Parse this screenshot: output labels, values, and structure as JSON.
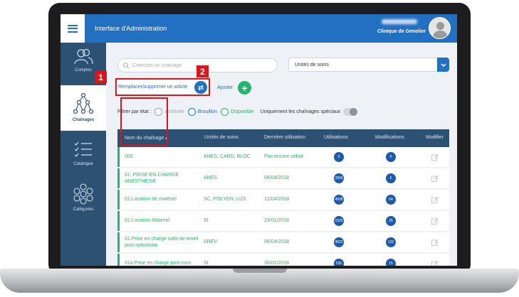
{
  "header": {
    "title": "Interface d'Administration",
    "clinic": "Clinique de Genolier"
  },
  "sidebar": {
    "items": [
      {
        "label": "Comptes",
        "icon": "users-icon"
      },
      {
        "label": "Chaînages",
        "icon": "network-icon",
        "active": true
      },
      {
        "label": "Catalogue",
        "icon": "checklist-icon"
      },
      {
        "label": "Catégories",
        "icon": "categories-icon"
      }
    ]
  },
  "search": {
    "placeholder": "Chercher un chaînage"
  },
  "units_select": {
    "value": "Unités de soins"
  },
  "actions": {
    "replace_label": "Remplacer/supprimer un article",
    "add_label": "Ajouter"
  },
  "badges": {
    "one": "1",
    "two": "2"
  },
  "filter": {
    "label": "Filtrer par état :",
    "options": [
      "Archivée",
      "Brouillon",
      "Disponible"
    ],
    "special_label": "Uniquement les chaînages spéciaux"
  },
  "table": {
    "headers": [
      "Nom du chaînage ▴",
      "Unités de soins",
      "Dernière utilisation",
      "Utilisations",
      "Modifications",
      "Modifier"
    ],
    "rows": [
      {
        "name": "000",
        "units": "ANES, CARD, BLOC",
        "last": "Pas encore utilisé",
        "uses": "0",
        "mods": "0"
      },
      {
        "name": "01. PRISE EN CHARGE ANESTHESIE",
        "units": "ANES",
        "last": "06/04/2018",
        "uses": "2836",
        "mods": "6"
      },
      {
        "name": "01.Location de matériel",
        "units": "SC, POLYDN, U2S",
        "last": "12/04/2018",
        "uses": "4508",
        "mods": "64"
      },
      {
        "name": "01.Location Materiel",
        "units": "SI",
        "last": "23/01/2018",
        "uses": "1509",
        "mods": "25"
      },
      {
        "name": "01.Prise en charge salle de reveil post opératoire",
        "units": "SREV",
        "last": "06/04/2018",
        "uses": "4623",
        "mods": "132"
      },
      {
        "name": "01a.Prise en charge post coro",
        "units": "SI",
        "last": "30/01/2018",
        "uses": "535",
        "mods": "15"
      }
    ]
  },
  "device": {
    "label": "MacBook Pro"
  },
  "colors": {
    "header_blue": "#2270c2",
    "sidebar_navy": "#2c5173",
    "accent_green": "#25b56a",
    "callout_red": "#d7161d"
  }
}
